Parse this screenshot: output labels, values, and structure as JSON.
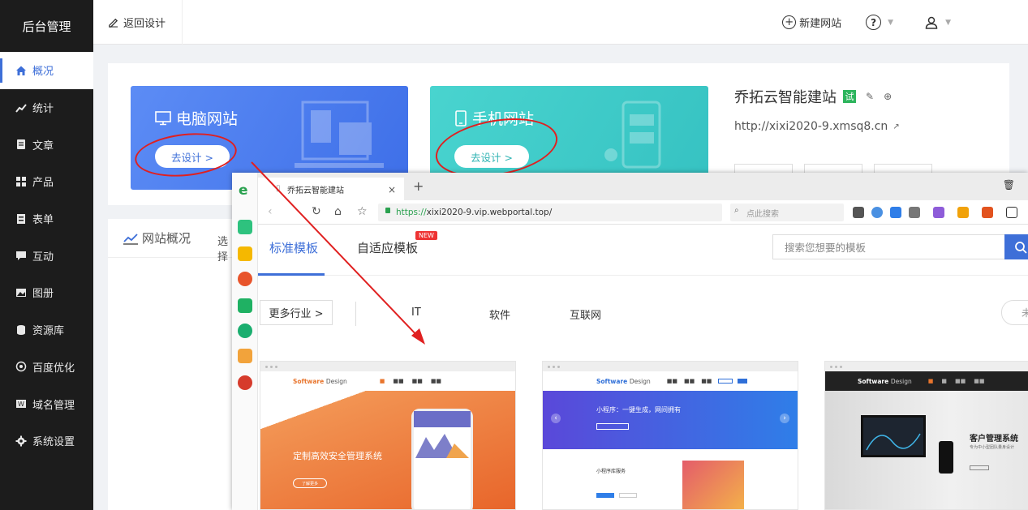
{
  "sidebar": {
    "brand": "后台管理",
    "items": [
      {
        "label": "概况",
        "icon": "home-icon"
      },
      {
        "label": "统计",
        "icon": "chart-icon"
      },
      {
        "label": "文章",
        "icon": "document-icon"
      },
      {
        "label": "产品",
        "icon": "grid-icon"
      },
      {
        "label": "表单",
        "icon": "form-icon"
      },
      {
        "label": "互动",
        "icon": "chat-icon"
      },
      {
        "label": "图册",
        "icon": "image-icon"
      },
      {
        "label": "资源库",
        "icon": "database-icon"
      },
      {
        "label": "百度优化",
        "icon": "target-icon"
      },
      {
        "label": "域名管理",
        "icon": "domain-icon"
      },
      {
        "label": "系统设置",
        "icon": "gear-icon"
      }
    ]
  },
  "header": {
    "back_label": "返回设计",
    "new_site_label": "新建网站"
  },
  "cards": {
    "pc_title": "电脑网站",
    "pc_button": "去设计 >",
    "mobile_title": "手机网站",
    "mobile_button": "去设计 >"
  },
  "site_info": {
    "name": "乔拓云智能建站",
    "badge": "试",
    "url": "http://xixi2020-9.xmsq8.cn"
  },
  "overview": {
    "title": "网站概况",
    "select": "选择"
  },
  "browser": {
    "tab_title": "乔拓云智能建站",
    "url_scheme": "https://",
    "url_rest": "xixi2020-9.vip.webportal.top/",
    "search_placeholder": "点此搜索",
    "tpl_tabs": [
      "标准模板",
      "自适应模板"
    ],
    "new_badge": "NEW",
    "tpl_search_placeholder": "搜索您想要的模板",
    "more_industry": "更多行业 >",
    "filters": [
      "IT",
      "软件",
      "互联网"
    ],
    "filter_right": "未",
    "templates": [
      {
        "logo": "Software",
        "logo_sub": "Design",
        "headline": "定制高效安全管理系统",
        "cta": "了解更多"
      },
      {
        "logo": "Software",
        "logo_sub": "Design",
        "headline": "小程序：一键生成，网间拥有",
        "section": "小程序库服务"
      },
      {
        "logo": "Software",
        "logo_sub": "Design",
        "headline": "客户管理系统",
        "sub": "专为中小型团队量身设计"
      }
    ]
  },
  "colors": {
    "sidebar_bg": "#1c1c1c",
    "accent": "#3e6fd8",
    "pc_card": "#4f7ff0",
    "mobile_card": "#40cdc9",
    "annotation_red": "#e02020"
  }
}
